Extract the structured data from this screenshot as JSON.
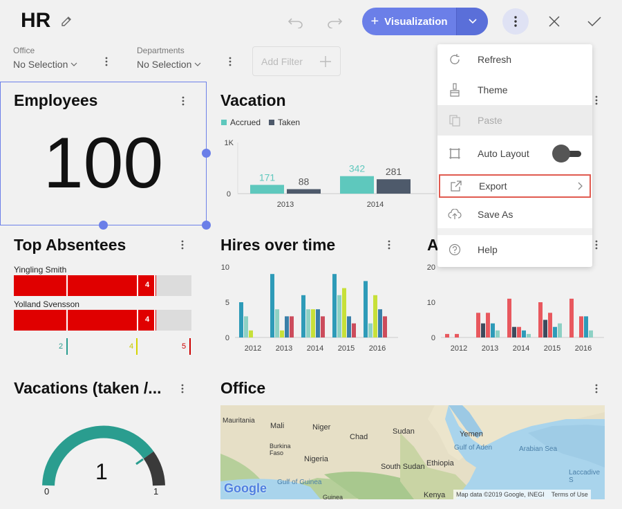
{
  "header": {
    "title": "HR",
    "visualization_label": "Visualization",
    "colors": {
      "accent": "#6b7fe8",
      "accent_dark": "#5a6fd9"
    }
  },
  "filters": [
    {
      "label": "Office",
      "value": "No Selection"
    },
    {
      "label": "Departments",
      "value": "No Selection"
    }
  ],
  "add_filter_label": "Add Filter",
  "cards": {
    "employees": {
      "title": "Employees",
      "value": "100"
    },
    "vacation": {
      "title": "Vacation",
      "legend": [
        {
          "name": "Accrued",
          "color": "#5ec8bd"
        },
        {
          "name": "Taken",
          "color": "#4e5a6b"
        }
      ],
      "y_ticks": [
        "1K",
        "0"
      ]
    },
    "top_absentees": {
      "title": "Top Absentees",
      "rows": [
        {
          "name": "Yingling Smith",
          "value": "4"
        },
        {
          "name": "Yolland Svensson",
          "value": "4"
        }
      ],
      "markers": [
        {
          "value": "2",
          "color": "#2a9d8f"
        },
        {
          "value": "4",
          "color": "#d4d400"
        },
        {
          "value": "5",
          "color": "#cc0000"
        }
      ]
    },
    "hires": {
      "title": "Hires over time",
      "y_ticks": [
        "10",
        "5",
        "0"
      ]
    },
    "absences": {
      "title": "A",
      "y_ticks": [
        "20",
        "10",
        "0"
      ]
    },
    "vacations_taken": {
      "title": "Vacations (taken /...",
      "value": "1",
      "min": "0",
      "max": "1"
    },
    "office": {
      "title": "Office",
      "map_labels": [
        "Mauritania",
        "Mali",
        "Niger",
        "Chad",
        "Sudan",
        "Yemen",
        "Burkina Faso",
        "Nigeria",
        "Ethiopia",
        "South Sudan",
        "Gulf of Aden",
        "Arabian Sea",
        "Gulf of Guinea",
        "Kenya",
        "Laccadive S",
        "Guinea"
      ],
      "attribution": "Map data ©2019 Google, INEGI",
      "terms": "Terms of Use",
      "logo": "Google"
    }
  },
  "menu": {
    "items": [
      {
        "label": "Refresh",
        "icon": "refresh-icon",
        "disabled": false
      },
      {
        "label": "Theme",
        "icon": "brush-icon",
        "disabled": false
      },
      {
        "label": "Paste",
        "icon": "paste-icon",
        "disabled": true
      },
      {
        "label": "Auto Layout",
        "icon": "auto-layout-icon",
        "disabled": false,
        "toggle": "off"
      },
      {
        "label": "Export",
        "icon": "export-icon",
        "disabled": false,
        "highlighted": true
      },
      {
        "label": "Save As",
        "icon": "cloud-upload-icon",
        "disabled": false
      },
      {
        "label": "Help",
        "icon": "help-icon",
        "disabled": false
      }
    ]
  },
  "chart_data": [
    {
      "type": "bar",
      "title": "Vacation",
      "categories": [
        "2013",
        "2014"
      ],
      "series": [
        {
          "name": "Accrued",
          "values": [
            171,
            342
          ]
        },
        {
          "name": "Taken",
          "values": [
            88,
            281
          ]
        }
      ],
      "ylim": [
        0,
        1000
      ]
    },
    {
      "type": "bar",
      "title": "Hires over time",
      "categories": [
        "2012",
        "2013",
        "2014",
        "2015",
        "2016"
      ],
      "series": [
        {
          "values": [
            5,
            9,
            6,
            9,
            8
          ]
        },
        {
          "values": [
            3,
            4,
            4,
            6,
            2
          ]
        },
        {
          "values": [
            1,
            1,
            4,
            7,
            6
          ]
        },
        {
          "values": [
            0,
            3,
            4,
            3,
            4
          ]
        },
        {
          "values": [
            0,
            3,
            3,
            2,
            3
          ]
        }
      ],
      "ylim": [
        0,
        10
      ]
    },
    {
      "type": "bar",
      "title": "A",
      "categories": [
        "2012",
        "2013",
        "2014",
        "2015",
        "2016"
      ],
      "series": [
        {
          "values": [
            1,
            7,
            11,
            10,
            11
          ]
        },
        {
          "values": [
            0,
            4,
            3,
            5,
            0
          ]
        },
        {
          "values": [
            1,
            7,
            3,
            7,
            6
          ]
        },
        {
          "values": [
            0,
            4,
            2,
            3,
            6
          ]
        },
        {
          "values": [
            0,
            2,
            1,
            4,
            2
          ]
        }
      ],
      "ylim": [
        0,
        20
      ]
    }
  ]
}
